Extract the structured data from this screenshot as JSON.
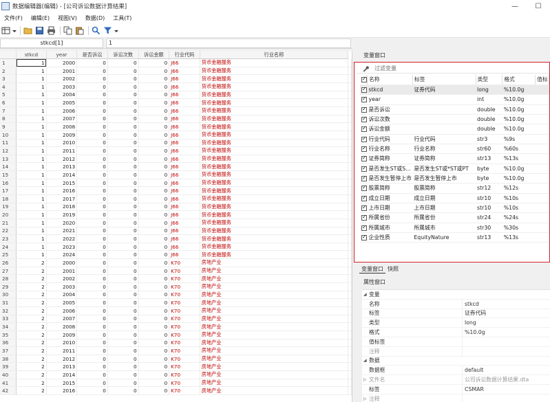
{
  "window": {
    "title": "数据编辑器(编辑) - [公司诉讼数据计算结果]",
    "min": "—",
    "max": "☐"
  },
  "menu": [
    "文件(F)",
    "编辑(E)",
    "视图(V)",
    "数据(D)",
    "工具(T)"
  ],
  "cellbar": {
    "varname": "stkcd[1]",
    "value": "1"
  },
  "grid": {
    "columns": [
      "stkcd",
      "year",
      "是否诉讼",
      "诉讼次数",
      "诉讼金额",
      "行业代码",
      "行业名称"
    ],
    "rows": [
      [
        "1",
        "1",
        "2000",
        "0",
        "0",
        "0",
        "J66",
        "货币金融服务"
      ],
      [
        "2",
        "1",
        "2001",
        "0",
        "0",
        "0",
        "J66",
        "货币金融服务"
      ],
      [
        "3",
        "1",
        "2002",
        "0",
        "0",
        "0",
        "J66",
        "货币金融服务"
      ],
      [
        "4",
        "1",
        "2003",
        "0",
        "0",
        "0",
        "J66",
        "货币金融服务"
      ],
      [
        "5",
        "1",
        "2004",
        "0",
        "0",
        "0",
        "J66",
        "货币金融服务"
      ],
      [
        "6",
        "1",
        "2005",
        "0",
        "0",
        "0",
        "J66",
        "货币金融服务"
      ],
      [
        "7",
        "1",
        "2006",
        "0",
        "0",
        "0",
        "J66",
        "货币金融服务"
      ],
      [
        "8",
        "1",
        "2007",
        "0",
        "0",
        "0",
        "J66",
        "货币金融服务"
      ],
      [
        "9",
        "1",
        "2008",
        "0",
        "0",
        "0",
        "J66",
        "货币金融服务"
      ],
      [
        "10",
        "1",
        "2009",
        "0",
        "0",
        "0",
        "J66",
        "货币金融服务"
      ],
      [
        "11",
        "1",
        "2010",
        "0",
        "0",
        "0",
        "J66",
        "货币金融服务"
      ],
      [
        "12",
        "1",
        "2011",
        "0",
        "0",
        "0",
        "J66",
        "货币金融服务"
      ],
      [
        "13",
        "1",
        "2012",
        "0",
        "0",
        "0",
        "J66",
        "货币金融服务"
      ],
      [
        "14",
        "1",
        "2013",
        "0",
        "0",
        "0",
        "J66",
        "货币金融服务"
      ],
      [
        "15",
        "1",
        "2014",
        "0",
        "0",
        "0",
        "J66",
        "货币金融服务"
      ],
      [
        "16",
        "1",
        "2015",
        "0",
        "0",
        "0",
        "J66",
        "货币金融服务"
      ],
      [
        "17",
        "1",
        "2016",
        "0",
        "0",
        "0",
        "J66",
        "货币金融服务"
      ],
      [
        "18",
        "1",
        "2017",
        "0",
        "0",
        "0",
        "J66",
        "货币金融服务"
      ],
      [
        "19",
        "1",
        "2018",
        "0",
        "0",
        "0",
        "J66",
        "货币金融服务"
      ],
      [
        "20",
        "1",
        "2019",
        "0",
        "0",
        "0",
        "J66",
        "货币金融服务"
      ],
      [
        "21",
        "1",
        "2020",
        "0",
        "0",
        "0",
        "J66",
        "货币金融服务"
      ],
      [
        "22",
        "1",
        "2021",
        "0",
        "0",
        "0",
        "J66",
        "货币金融服务"
      ],
      [
        "23",
        "1",
        "2022",
        "0",
        "0",
        "0",
        "J66",
        "货币金融服务"
      ],
      [
        "24",
        "1",
        "2023",
        "0",
        "0",
        "0",
        "J66",
        "货币金融服务"
      ],
      [
        "25",
        "1",
        "2024",
        "0",
        "0",
        "0",
        "J66",
        "货币金融服务"
      ],
      [
        "26",
        "2",
        "2000",
        "0",
        "0",
        "0",
        "K70",
        "房地产业"
      ],
      [
        "27",
        "2",
        "2001",
        "0",
        "0",
        "0",
        "K70",
        "房地产业"
      ],
      [
        "28",
        "2",
        "2002",
        "0",
        "0",
        "0",
        "K70",
        "房地产业"
      ],
      [
        "29",
        "2",
        "2003",
        "0",
        "0",
        "0",
        "K70",
        "房地产业"
      ],
      [
        "30",
        "2",
        "2004",
        "0",
        "0",
        "0",
        "K70",
        "房地产业"
      ],
      [
        "31",
        "2",
        "2005",
        "0",
        "0",
        "0",
        "K70",
        "房地产业"
      ],
      [
        "32",
        "2",
        "2006",
        "0",
        "0",
        "0",
        "K70",
        "房地产业"
      ],
      [
        "33",
        "2",
        "2007",
        "0",
        "0",
        "0",
        "K70",
        "房地产业"
      ],
      [
        "34",
        "2",
        "2008",
        "0",
        "0",
        "0",
        "K70",
        "房地产业"
      ],
      [
        "35",
        "2",
        "2009",
        "0",
        "0",
        "0",
        "K70",
        "房地产业"
      ],
      [
        "36",
        "2",
        "2010",
        "0",
        "0",
        "0",
        "K70",
        "房地产业"
      ],
      [
        "37",
        "2",
        "2011",
        "0",
        "0",
        "0",
        "K70",
        "房地产业"
      ],
      [
        "38",
        "2",
        "2012",
        "0",
        "0",
        "0",
        "K70",
        "房地产业"
      ],
      [
        "39",
        "2",
        "2013",
        "0",
        "0",
        "0",
        "K70",
        "房地产业"
      ],
      [
        "40",
        "2",
        "2014",
        "0",
        "0",
        "0",
        "K70",
        "房地产业"
      ],
      [
        "41",
        "2",
        "2015",
        "0",
        "0",
        "0",
        "K70",
        "房地产业"
      ],
      [
        "42",
        "2",
        "2016",
        "0",
        "0",
        "0",
        "K70",
        "房地产业"
      ]
    ]
  },
  "variables_window": {
    "title": "变量窗口",
    "filter_placeholder": "过滤变量",
    "headers": [
      "名称",
      "标签",
      "类型",
      "格式",
      "值标"
    ],
    "rows": [
      [
        "stkcd",
        "证券代码",
        "long",
        "%10.0g"
      ],
      [
        "year",
        "",
        "int",
        "%10.0g"
      ],
      [
        "是否诉讼",
        "",
        "double",
        "%10.0g"
      ],
      [
        "诉讼次数",
        "",
        "double",
        "%10.0g"
      ],
      [
        "诉讼金额",
        "",
        "double",
        "%10.0g"
      ],
      [
        "行业代码",
        "行业代码",
        "str3",
        "%9s"
      ],
      [
        "行业名称",
        "行业名称",
        "str60",
        "%60s"
      ],
      [
        "证券简称",
        "证券简称",
        "str13",
        "%13s"
      ],
      [
        "是否发生ST或S...",
        "是否发生ST或*ST或PT",
        "byte",
        "%10.0g"
      ],
      [
        "是否发生暂停上市",
        "是否发生暂停上市",
        "byte",
        "%10.0g"
      ],
      [
        "股票简称",
        "股票简称",
        "str12",
        "%12s"
      ],
      [
        "成立日期",
        "成立日期",
        "str10",
        "%10s"
      ],
      [
        "上市日期",
        "上市日期",
        "str10",
        "%10s"
      ],
      [
        "所属省份",
        "所属省份",
        "str24",
        "%24s"
      ],
      [
        "所属城市",
        "所属城市",
        "str30",
        "%30s"
      ],
      [
        "企业性质",
        "EquityNature",
        "str13",
        "%13s"
      ]
    ]
  },
  "tabs": [
    "变量窗口",
    "快照"
  ],
  "properties_window": {
    "title": "属性窗口",
    "section_var": "变量",
    "var_rows": [
      [
        "名称",
        "stkcd"
      ],
      [
        "标签",
        "证券代码"
      ],
      [
        "类型",
        "long"
      ],
      [
        "格式",
        "%10.0g"
      ],
      [
        "值标签",
        ""
      ],
      [
        "注释",
        ""
      ]
    ],
    "section_data": "数据",
    "data_rows": [
      [
        "数据框",
        "default"
      ],
      [
        "文件名",
        "公司诉讼数据计算结果.dta"
      ],
      [
        "标签",
        "CSMAR"
      ],
      [
        "注释",
        ""
      ]
    ]
  }
}
